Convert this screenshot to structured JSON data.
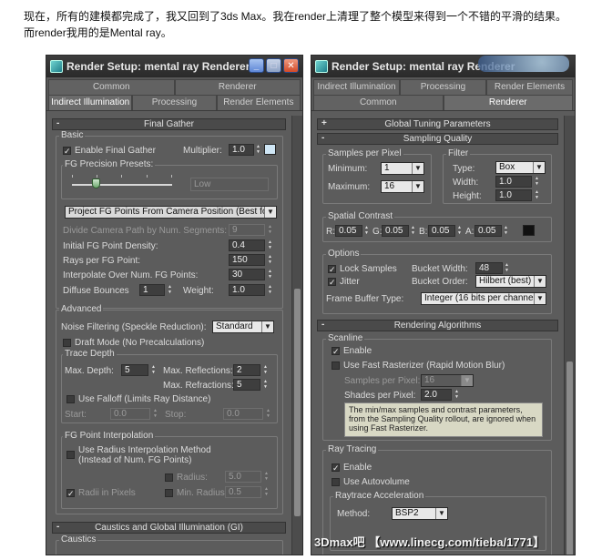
{
  "caption": [
    "现在，所有的建模都完成了，我又回到了3ds Max。我在render上清理了整个模型来得到一个不错的平滑的结果。",
    "而render我用的是Mental ray。"
  ],
  "w1": {
    "title": "Render Setup: mental ray Renderer",
    "tabs_row1": [
      "Common",
      "Renderer"
    ],
    "tabs_row2": [
      "Indirect Illumination",
      "Processing",
      "Render Elements"
    ],
    "rollout": "Final Gather",
    "basic": "Basic",
    "enable_fg": "Enable Final Gather",
    "multiplier_label": "Multiplier:",
    "multiplier": "1.0",
    "presets_label": "FG Precision Presets:",
    "preset_value": "Low",
    "project_dd": "Project FG Points From Camera Position (Best for Stills)",
    "divide_label": "Divide Camera Path by Num. Segments:",
    "divide_value": "9",
    "density_label": "Initial FG Point Density:",
    "density": "0.4",
    "rays_label": "Rays per FG Point:",
    "rays": "150",
    "interp_label": "Interpolate Over Num. FG Points:",
    "interp": "30",
    "bounces_label": "Diffuse Bounces",
    "bounces": "1",
    "weight_label": "Weight:",
    "weight": "1.0",
    "advanced": "Advanced",
    "noise_label": "Noise Filtering (Speckle Reduction):",
    "noise": "Standard",
    "draft": "Draft Mode (No Precalculations)",
    "trace_depth": "Trace Depth",
    "max_depth_label": "Max. Depth:",
    "max_depth": "5",
    "max_refl_label": "Max. Reflections:",
    "max_refl": "2",
    "max_refr_label": "Max. Refractions:",
    "max_refr": "5",
    "falloff": "Use Falloff (Limits Ray Distance)",
    "start_label": "Start:",
    "start": "0.0",
    "stop_label": "Stop:",
    "stop": "0.0",
    "fgpi": "FG Point Interpolation",
    "use_radius": "Use Radius Interpolation Method",
    "use_radius2": "(Instead of Num. FG Points)",
    "radius_label": "Radius:",
    "radius": "5.0",
    "radii_px": "Radii in Pixels",
    "min_radius_label": "Min. Radius:",
    "min_radius": "0.5",
    "caustics_roll": "Caustics and Global Illumination (GI)",
    "caustics": "Caustics"
  },
  "w2": {
    "title": "Render Setup: mental ray Renderer",
    "tabs_row1": [
      "Indirect Illumination",
      "Processing",
      "Render Elements"
    ],
    "tabs_row2": [
      "Common",
      "Renderer"
    ],
    "roll_global": "Global Tuning Parameters",
    "roll_sampling": "Sampling Quality",
    "spp": "Samples per Pixel",
    "minimum_label": "Minimum:",
    "minimum": "1",
    "maximum_label": "Maximum:",
    "maximum": "16",
    "filter": "Filter",
    "type_label": "Type:",
    "type": "Box",
    "width_label": "Width:",
    "width": "1.0",
    "height_label": "Height:",
    "height": "1.0",
    "spatial": "Spatial Contrast",
    "r_label": "R:",
    "r": "0.05",
    "g_label": "G:",
    "g": "0.05",
    "b_label": "B:",
    "b": "0.05",
    "a_label": "A:",
    "a": "0.05",
    "options": "Options",
    "lock": "Lock Samples",
    "jitter": "Jitter",
    "bucket_w_label": "Bucket Width:",
    "bucket_w": "48",
    "bucket_o_label": "Bucket Order:",
    "bucket_o": "Hilbert (best)",
    "fb_label": "Frame Buffer Type:",
    "fb": "Integer (16 bits per channel)",
    "roll_algo": "Rendering Algorithms",
    "scanline": "Scanline",
    "enable": "Enable",
    "fast_raster": "Use Fast Rasterizer (Rapid Motion Blur)",
    "spp2_label": "Samples per Pixel:",
    "spp2": "16",
    "shades_label": "Shades per Pixel:",
    "shades": "2.0",
    "info": "The min/max samples and contrast parameters, from the Sampling Quality rollout, are ignored when using Fast Rasterizer.",
    "raytracing": "Ray Tracing",
    "rt_enable": "Enable",
    "autovolume": "Use Autovolume",
    "rt_accel": "Raytrace Acceleration",
    "method_label": "Method:",
    "method": "BSP2"
  },
  "watermark": "3Dmax吧  【www.linecg.com/tieba/1771】",
  "colors": {
    "panel": "#5c5c5c",
    "title": "#2f2f2f",
    "swatch_multiplier": "#cfe6f5",
    "swatch_contrast": "#111111"
  }
}
